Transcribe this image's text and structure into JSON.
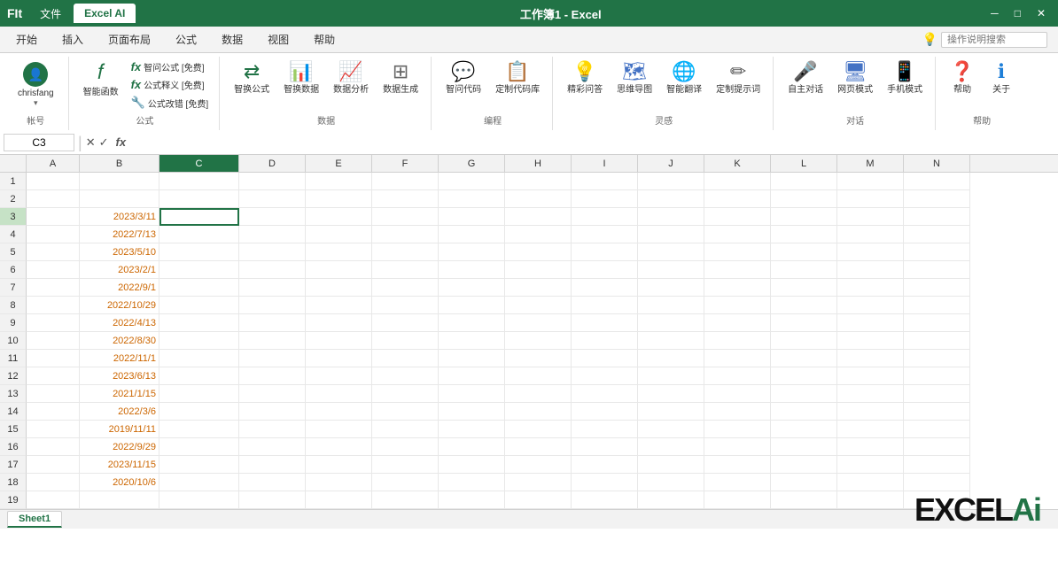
{
  "titlebar": {
    "logo": "FIt",
    "file_tab": "文件",
    "excel_ai_tab": "Excel AI",
    "tabs": [
      "开始",
      "插入",
      "页面布局",
      "公式",
      "数据",
      "视图",
      "帮助"
    ],
    "search_placeholder": "操作说明搜索",
    "title": "工作簿1 - Excel"
  },
  "ribbon": {
    "active_tab": "Excel AI",
    "groups": {
      "account": {
        "label": "帐号",
        "user": "chrisfang"
      },
      "formula": {
        "label": "公式",
        "items": [
          {
            "id": "smart-func",
            "icon": "🔢",
            "label": "智能函数"
          },
          {
            "id": "ask-formula",
            "icon": "fx",
            "label": "智问公式\n[免费]"
          },
          {
            "id": "formula-explain",
            "icon": "fx",
            "label": "公式释义\n[免费]"
          },
          {
            "id": "formula-fix",
            "icon": "🔧",
            "label": "公式改错\n[免费]"
          }
        ]
      },
      "data": {
        "label": "数据",
        "items": [
          {
            "id": "smart-replace",
            "icon": "⇄",
            "label": "智换公式"
          },
          {
            "id": "smart-data",
            "icon": "📊",
            "label": "智换数据"
          },
          {
            "id": "data-analysis",
            "icon": "📈",
            "label": "数据分析"
          },
          {
            "id": "data-gen",
            "icon": "🔲",
            "label": "数据生成"
          }
        ]
      },
      "programming": {
        "label": "编程",
        "items": [
          {
            "id": "ask-code",
            "icon": "💬",
            "label": "智问代码"
          },
          {
            "id": "gen-code",
            "icon": "📋",
            "label": "定制代码库"
          }
        ]
      },
      "inspiration": {
        "label": "灵感",
        "items": [
          {
            "id": "smart-qa",
            "icon": "💡",
            "label": "精彩问答"
          },
          {
            "id": "mind-map",
            "icon": "🗺",
            "label": "思维导图"
          },
          {
            "id": "smart-translate",
            "icon": "🌐",
            "label": "智能翻译"
          },
          {
            "id": "custom-prompt",
            "icon": "✏",
            "label": "定制提示词"
          }
        ]
      },
      "dialogue": {
        "label": "对话",
        "items": [
          {
            "id": "self-talk",
            "icon": "🎤",
            "label": "自主对话"
          },
          {
            "id": "web-mode",
            "icon": "🖥",
            "label": "网页模式"
          },
          {
            "id": "mobile-mode",
            "icon": "📱",
            "label": "手机模式"
          }
        ]
      },
      "help": {
        "label": "帮助",
        "items": [
          {
            "id": "help",
            "icon": "❓",
            "label": "帮助"
          },
          {
            "id": "about",
            "icon": "ℹ",
            "label": "关于"
          }
        ]
      }
    }
  },
  "formula_bar": {
    "cell_ref": "C3",
    "formula": ""
  },
  "columns": [
    "A",
    "B",
    "C",
    "D",
    "E",
    "F",
    "G",
    "H",
    "I",
    "J",
    "K",
    "L",
    "M",
    "N"
  ],
  "rows": 19,
  "cells": {
    "B3": {
      "value": "2023/3/11",
      "color": "orange"
    },
    "B4": {
      "value": "2022/7/13",
      "color": "orange"
    },
    "B5": {
      "value": "2023/5/10",
      "color": "orange"
    },
    "B6": {
      "value": "2023/2/1",
      "color": "orange"
    },
    "B7": {
      "value": "2022/9/1",
      "color": "orange"
    },
    "B8": {
      "value": "2022/10/29",
      "color": "orange"
    },
    "B9": {
      "value": "2022/4/13",
      "color": "orange"
    },
    "B10": {
      "value": "2022/8/30",
      "color": "orange"
    },
    "B11": {
      "value": "2022/11/1",
      "color": "orange"
    },
    "B12": {
      "value": "2023/6/13",
      "color": "orange"
    },
    "B13": {
      "value": "2021/1/15",
      "color": "orange"
    },
    "B14": {
      "value": "2022/3/6",
      "color": "orange"
    },
    "B15": {
      "value": "2019/11/11",
      "color": "orange"
    },
    "B16": {
      "value": "2022/9/29",
      "color": "orange"
    },
    "B17": {
      "value": "2023/11/15",
      "color": "orange"
    },
    "B18": {
      "value": "2020/10/6",
      "color": "orange"
    }
  },
  "watermark": {
    "text_black": "EXCEL",
    "text_green": "Ai"
  },
  "sheet": {
    "tabs": [
      "Sheet1"
    ],
    "active": "Sheet1"
  }
}
